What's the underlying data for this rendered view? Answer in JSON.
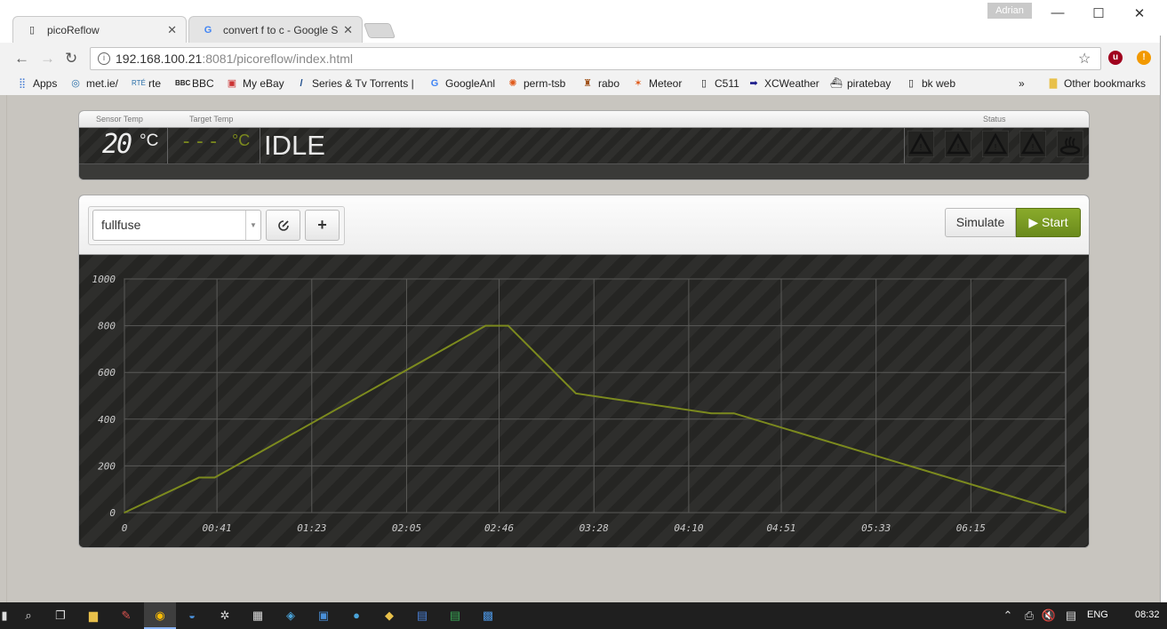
{
  "browser": {
    "profile_name": "Adrian",
    "tabs": [
      {
        "title": "picoReflow",
        "active": true
      },
      {
        "title": "convert f to c - Google S",
        "active": false
      }
    ],
    "url_host": "192.168.100.21",
    "url_rest": ":8081/picoreflow/index.html",
    "bookmarks": [
      {
        "label": "Apps",
        "icon": "apps-grid-icon"
      },
      {
        "label": "met.ie/",
        "icon": "met-ie-icon"
      },
      {
        "label": "rte",
        "icon": "rte-icon"
      },
      {
        "label": "BBC",
        "icon": "bbc-icon"
      },
      {
        "label": "My eBay",
        "icon": "ebay-bag-icon"
      },
      {
        "label": "Series & Tv Torrents |",
        "icon": "series-icon"
      },
      {
        "label": "GoogleAnl",
        "icon": "google-icon"
      },
      {
        "label": "perm-tsb",
        "icon": "perm-tsb-icon"
      },
      {
        "label": "rabo",
        "icon": "rabo-icon"
      },
      {
        "label": "Meteor",
        "icon": "meteor-icon"
      },
      {
        "label": "C511",
        "icon": "page-icon"
      },
      {
        "label": "XCWeather",
        "icon": "arrow-icon"
      },
      {
        "label": "piratebay",
        "icon": "ship-icon"
      },
      {
        "label": "bk web",
        "icon": "page-icon"
      }
    ],
    "bookmarks_more": "»",
    "other_bookmarks": "Other bookmarks"
  },
  "status": {
    "sensor_temp_label": "Sensor Temp",
    "target_temp_label": "Target Temp",
    "status_label": "Status",
    "sensor_temp_value": "20",
    "sensor_temp_unit": "°C",
    "target_temp_value": "---",
    "target_temp_unit": "°C",
    "state": "IDLE",
    "indicator_icons": [
      "warning-icon",
      "warning-icon",
      "warning-icon",
      "warning-icon",
      "heat-icon"
    ]
  },
  "controls": {
    "profile_selected": "fullfuse",
    "edit_icon": "edit-icon",
    "add_icon": "plus-icon",
    "simulate_label": "Simulate",
    "start_label": "Start",
    "play_icon": "play-icon"
  },
  "chart_data": {
    "type": "line",
    "title": "",
    "xlabel": "",
    "ylabel": "",
    "x_tick_labels": [
      "0",
      "00:41",
      "01:23",
      "02:05",
      "02:46",
      "03:28",
      "04:10",
      "04:51",
      "05:33",
      "06:15"
    ],
    "x_tick_seconds": [
      0,
      41,
      83,
      125,
      166,
      208,
      250,
      291,
      333,
      375
    ],
    "y_ticks": [
      0,
      200,
      400,
      600,
      800,
      1000
    ],
    "xlim": [
      0,
      417
    ],
    "ylim": [
      0,
      1000
    ],
    "grid": true,
    "series": [
      {
        "color": "#7c8a1e",
        "x": [
          0,
          33,
          40,
          160,
          170,
          200,
          260,
          270,
          417
        ],
        "y": [
          0,
          150,
          150,
          800,
          800,
          510,
          425,
          425,
          0
        ]
      }
    ]
  },
  "taskbar": {
    "language": "ENG",
    "time": "08:32"
  }
}
